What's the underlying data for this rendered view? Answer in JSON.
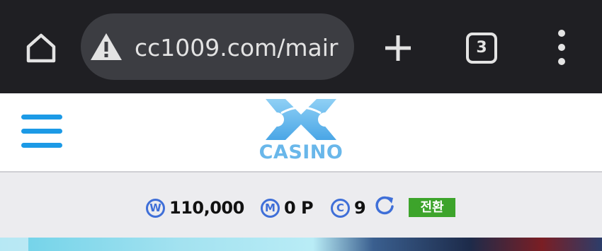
{
  "browser": {
    "url": "cc1009.com/mair",
    "tab_count": "3",
    "colors": {
      "bar_bg": "#1f1f23",
      "urlbar_bg": "#3c3d42",
      "icon": "#e3e3e3"
    },
    "icons": [
      "home-icon",
      "warning-icon",
      "plus-icon",
      "tab-switcher-icon",
      "more-vert-icon"
    ]
  },
  "site": {
    "logo_text": "CASINO",
    "colors": {
      "menu": "#1c9ae6",
      "logo": "#69b7ea"
    },
    "icons": [
      "hamburger-icon",
      "casino-logo-mark"
    ]
  },
  "balance": {
    "won_symbol": "W",
    "won_amount": "110,000",
    "mileage_symbol": "M",
    "mileage_amount": "0 P",
    "coin_symbol": "C",
    "coin_amount": "9",
    "switch_label": "전환",
    "colors": {
      "coin": "#3f6fd8",
      "switch_bg": "#3da42b"
    },
    "icons": [
      "won-icon",
      "mileage-icon",
      "coin-icon",
      "refresh-icon"
    ]
  }
}
